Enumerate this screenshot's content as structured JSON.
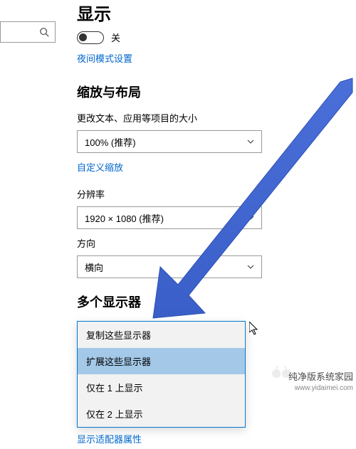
{
  "page_title": "显示",
  "toggle": {
    "state_label": "关"
  },
  "links": {
    "night_mode": "夜间模式设置",
    "custom_scaling": "自定义缩放",
    "adapter_props": "显示适配器属性"
  },
  "sections": {
    "scaling_layout": "缩放与布局",
    "multi_displays": "多个显示器"
  },
  "fields": {
    "text_scaling_label": "更改文本、应用等项目的大小",
    "text_scaling_value": "100% (推荐)",
    "resolution_label": "分辨率",
    "resolution_value": "1920 × 1080 (推荐)",
    "orientation_label": "方向",
    "orientation_value": "横向"
  },
  "multi_display_options": [
    "复制这些显示器",
    "扩展这些显示器",
    "仅在 1 上显示",
    "仅在 2 上显示"
  ],
  "watermark": {
    "title": "纯净版系统家园",
    "url": "www.yidaimei.com"
  }
}
